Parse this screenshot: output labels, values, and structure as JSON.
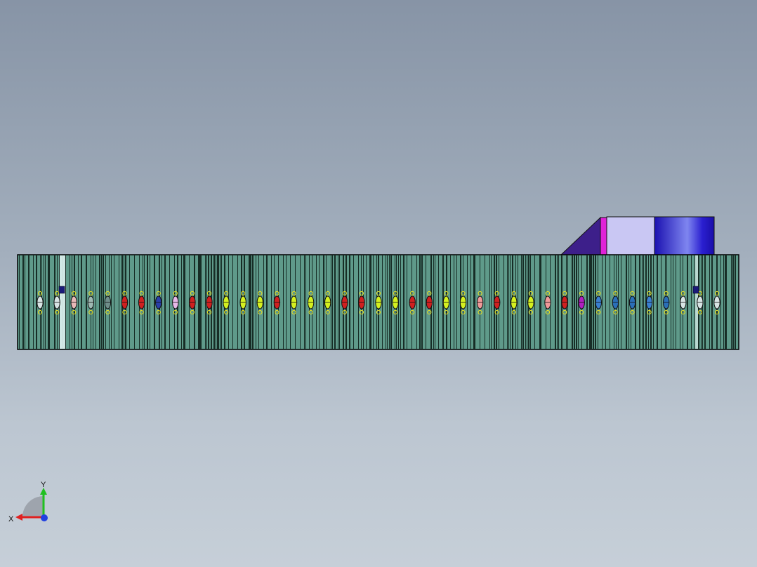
{
  "viewport": {
    "background_top": "#8794a6",
    "background_bottom": "#c6cfd8"
  },
  "model": {
    "body_color": "#5f9a8a",
    "stripe_color": "#0a1a14",
    "housing_light": "#c9c7f3",
    "housing_blue": "#2a1fd0",
    "ramp_color": "#3d1f8a",
    "magenta_strip": "#e022d8",
    "module_count": 41,
    "module_colors": [
      "#d7e4e4",
      "#d7e4e4",
      "#e7b8b8",
      "#9fb9b3",
      "#6f8e8a",
      "#cf2020",
      "#cf2020",
      "#2a3fa8",
      "#e8b8e8",
      "#cf2020",
      "#cf2020",
      "#d4f020",
      "#d4f020",
      "#d4f020",
      "#cf2020",
      "#d4f020",
      "#d4f020",
      "#d4f020",
      "#cf2020",
      "#cf2020",
      "#d4f020",
      "#d4f020",
      "#cf2020",
      "#cf2020",
      "#d4f020",
      "#d4f020",
      "#ef9a9a",
      "#cf2020",
      "#d4f020",
      "#d4f020",
      "#ef9a9a",
      "#cf2020",
      "#b020c0",
      "#3a7fd0",
      "#2a6fb8",
      "#2a6fb8",
      "#3a7fd0",
      "#2a6fb8",
      "#d7e4e4",
      "#d7e4e4",
      "#d7e4e4"
    ]
  },
  "triad": {
    "x_label": "X",
    "y_label": "Y",
    "x_color": "#e02020",
    "y_color": "#20c020",
    "z_color": "#2040e0"
  }
}
